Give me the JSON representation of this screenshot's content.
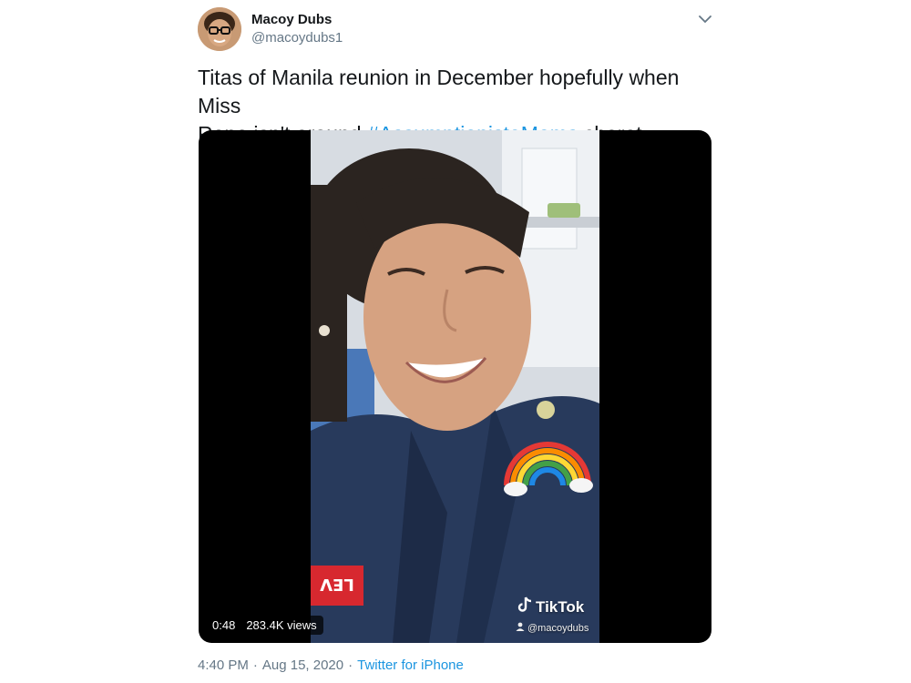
{
  "author": {
    "name": "Macoy Dubs",
    "handle": "@macoydubs1"
  },
  "tweet": {
    "text_line1": "Titas of Manila reunion in December hopefully when Miss",
    "text_line2_prefix": "Rona isn't around ",
    "hashtag": "#AssumptionistaMoms",
    "text_line2_suffix": " charot"
  },
  "video": {
    "duration": "0:48",
    "views": "283.4K views",
    "watermark_brand": "TikTok",
    "watermark_user": "@macoydubs",
    "jacket_patch_text": "LEV"
  },
  "footer": {
    "time": "4:40 PM",
    "date": "Aug 15, 2020",
    "source": "Twitter for iPhone"
  },
  "icons": {
    "more": "chevron-down-icon",
    "brand": "tiktok-note-icon",
    "user": "person-icon"
  },
  "colors": {
    "link": "#1b95e0",
    "secondary_text": "#657786",
    "primary_text": "#14171a"
  }
}
